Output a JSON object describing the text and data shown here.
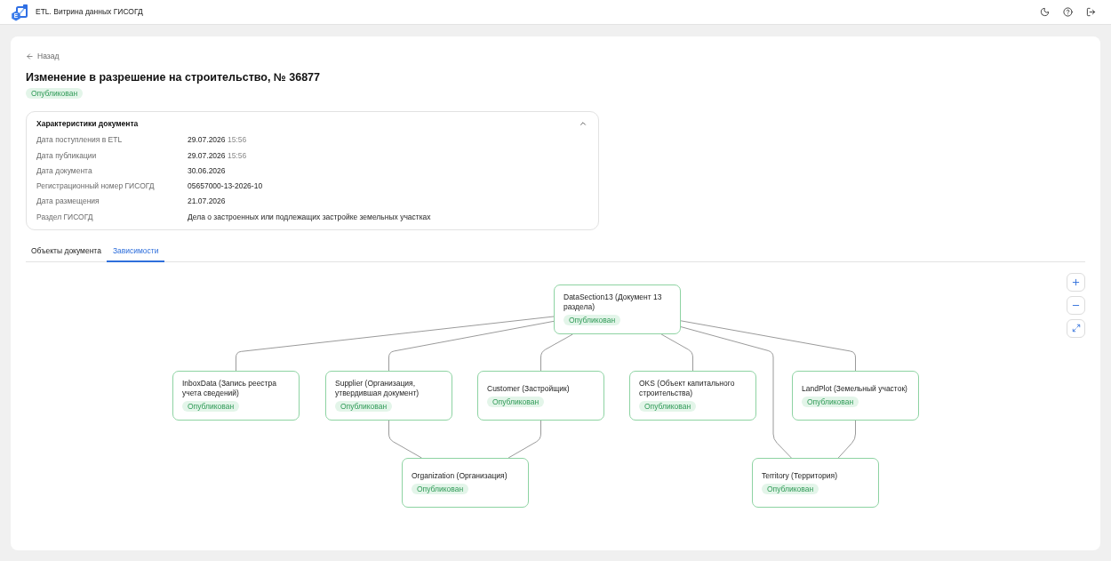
{
  "header": {
    "logo_letter": "E",
    "title": "ETL. Витрина данных ГИСОГД"
  },
  "back_link": "Назад",
  "document": {
    "title": "Изменение в разрешение на строительство, № 36877",
    "status": "Опубликован"
  },
  "properties": {
    "title": "Характеристики документа",
    "expanded": true,
    "rows": [
      {
        "label": "Дата поступления в ETL",
        "value": "29.07.2026",
        "time": "15:56"
      },
      {
        "label": "Дата публикации",
        "value": "29.07.2026",
        "time": "15:56"
      },
      {
        "label": "Дата документа",
        "value": "30.06.2026"
      },
      {
        "label": "Регистрационный номер ГИСОГД",
        "value": "05657000-13-2026-10"
      },
      {
        "label": "Дата размещения",
        "value": "21.07.2026"
      },
      {
        "label": "Раздел ГИСОГД",
        "value": "Дела о застроенных или подлежащих застройке земельных участках"
      }
    ]
  },
  "tabs": [
    {
      "label": "Объекты документа",
      "selected": false
    },
    {
      "label": "Зависимости",
      "selected": true
    }
  ],
  "graph": {
    "nodes": [
      {
        "title": "DataSection13 (Документ 13 раздела)",
        "status": "Опубликован"
      },
      {
        "title": "InboxData (Запись реестра учета сведений)",
        "status": "Опубликован"
      },
      {
        "title": "Supplier (Организация, утвердившая документ)",
        "status": "Опубликован"
      },
      {
        "title": "Customer (Застройщик)",
        "status": "Опубликован"
      },
      {
        "title": "OKS (Объект капитального строительства)",
        "status": "Опубликован"
      },
      {
        "title": "LandPlot (Земельный участок)",
        "status": "Опубликован"
      },
      {
        "title": "Organization (Организация)",
        "status": "Опубликован"
      },
      {
        "title": "Territory (Территория)",
        "status": "Опубликован"
      }
    ]
  }
}
